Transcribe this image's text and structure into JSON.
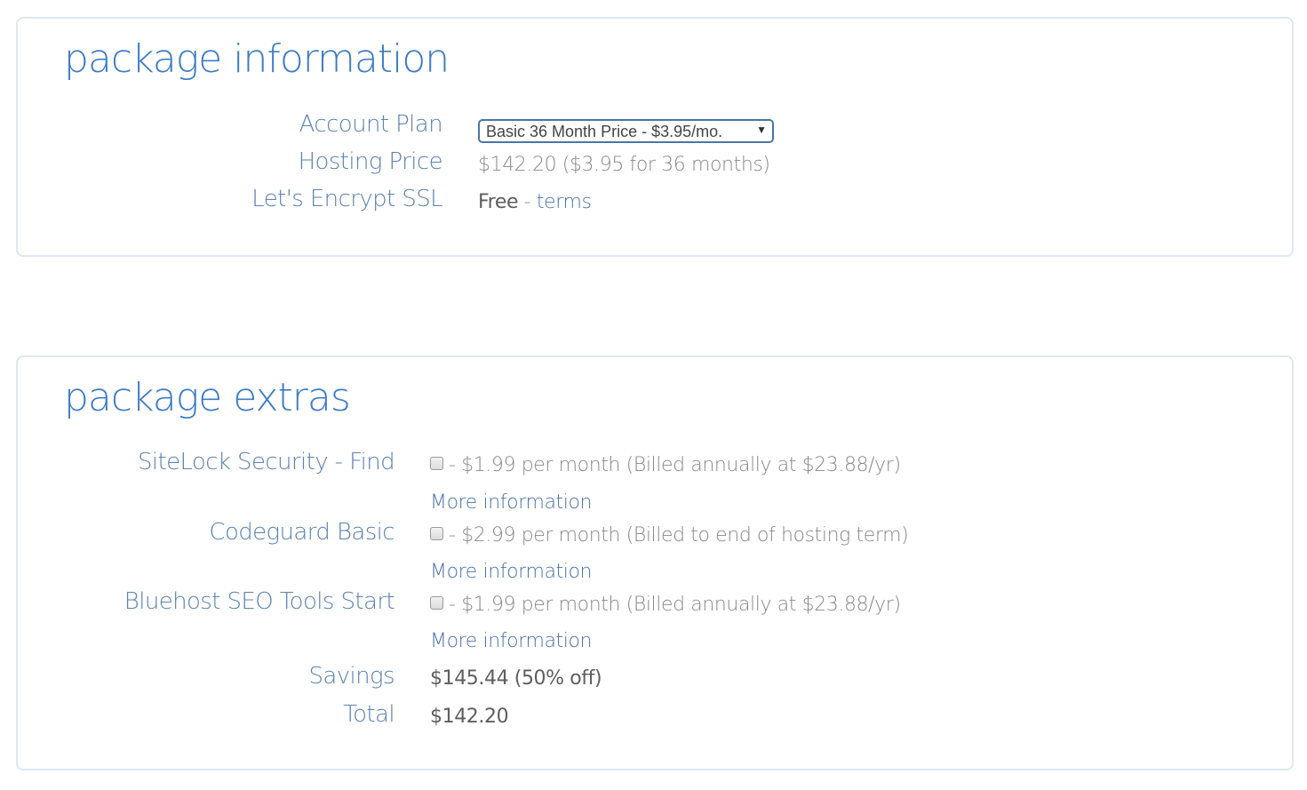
{
  "package_information": {
    "title": "package information",
    "account_plan": {
      "label": "Account Plan",
      "selected": "Basic 36 Month Price - $3.95/mo.",
      "arrow_icon": "▼"
    },
    "hosting_price": {
      "label": "Hosting Price",
      "value": "$142.20  ($3.95 for 36 months)"
    },
    "ssl": {
      "label": "Let's Encrypt SSL",
      "value": "Free",
      "separator": " - ",
      "link": "terms"
    }
  },
  "package_extras": {
    "title": "package extras",
    "items": [
      {
        "label": "SiteLock Security - Find",
        "checked": false,
        "price_text": "- $1.99 per month (Billed annually at $23.88/yr)",
        "more_link": "More information"
      },
      {
        "label": "Codeguard Basic",
        "checked": false,
        "price_text": "- $2.99 per month (Billed to end of hosting term)",
        "more_link": "More information"
      },
      {
        "label": "Bluehost SEO Tools Start",
        "checked": false,
        "price_text": "- $1.99 per month (Billed annually at $23.88/yr)",
        "more_link": "More information"
      }
    ],
    "savings": {
      "label": "Savings",
      "value": "$145.44 (50% off)"
    },
    "total": {
      "label": "Total",
      "value": "$142.20"
    }
  },
  "colors": {
    "heading_blue": "#3c7cc5",
    "label_blue": "#5b82b2",
    "link_blue": "#4a72ad",
    "panel_border": "#dde8f3",
    "value_gray": "#888888"
  }
}
